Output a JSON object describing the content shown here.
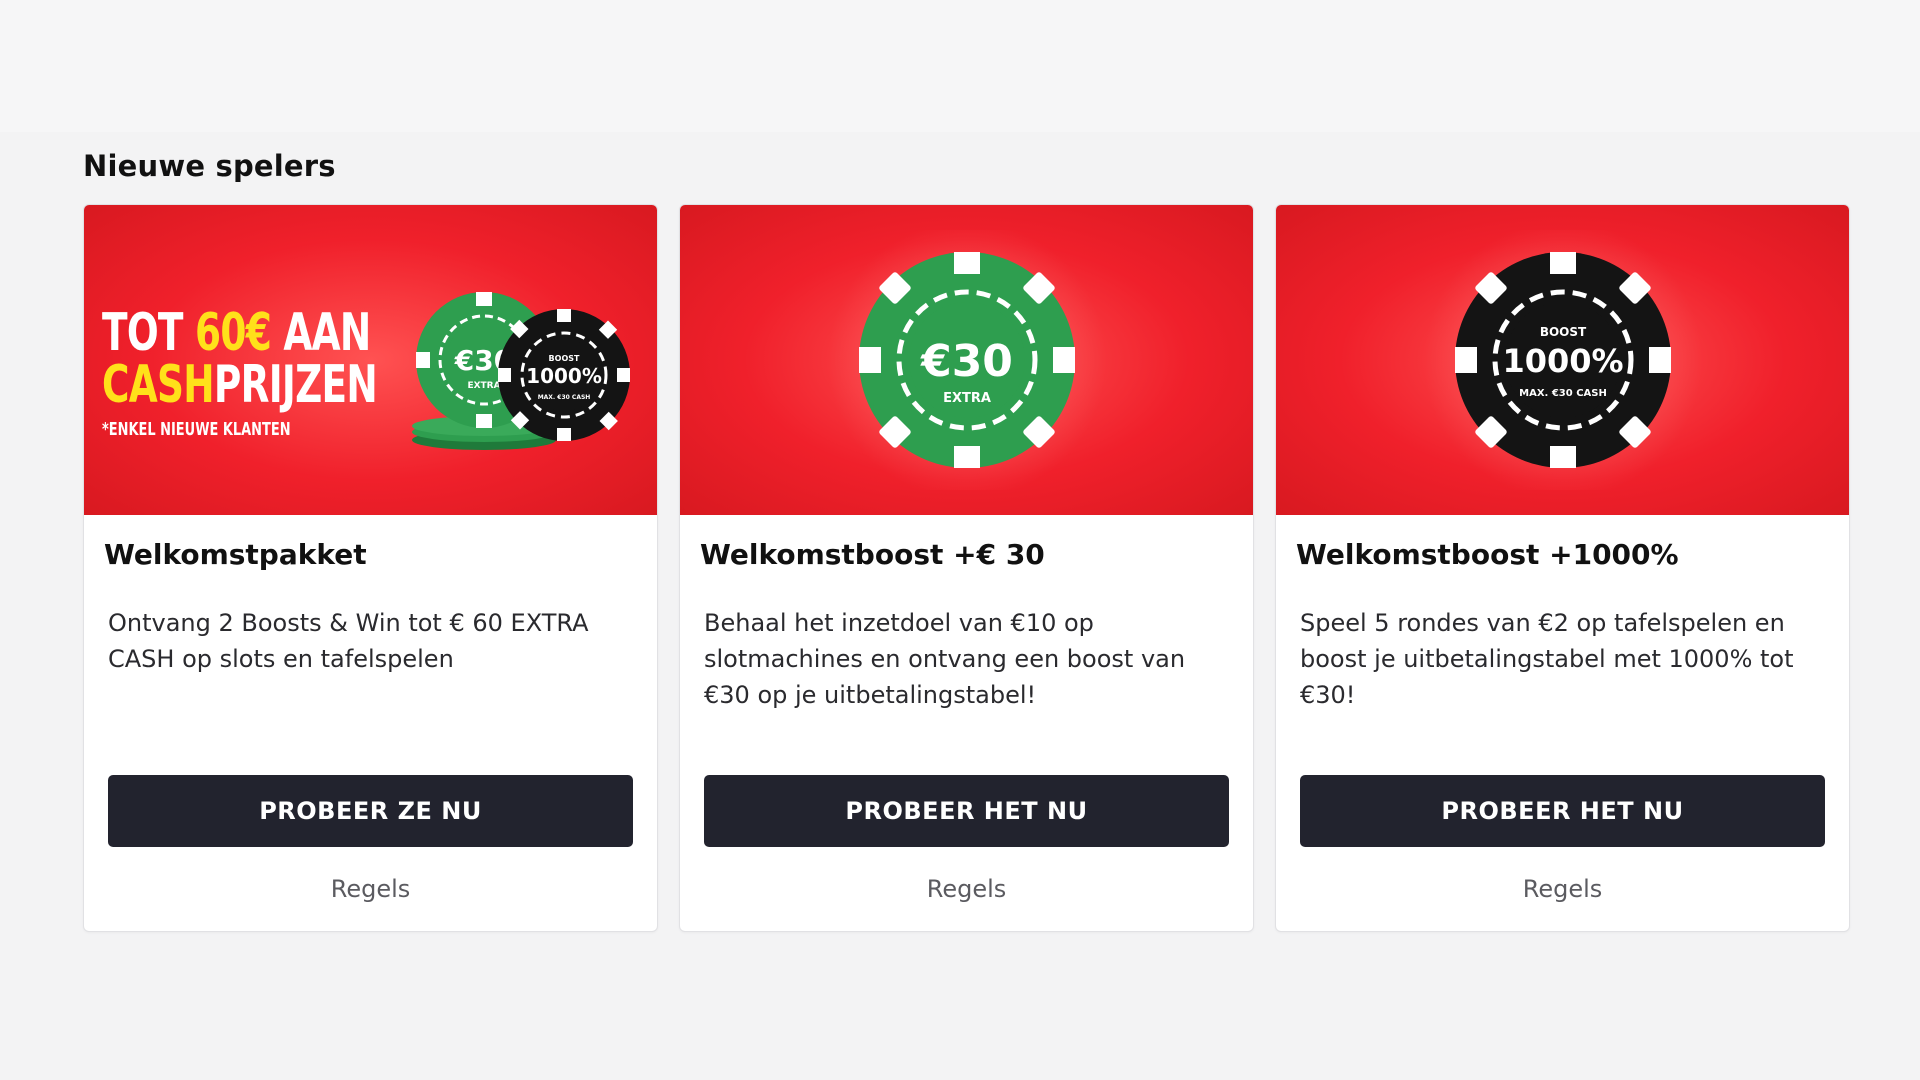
{
  "section": {
    "title": "Nieuwe spelers"
  },
  "colors": {
    "banner_red": "#f0202b",
    "cta_dark": "#22232e",
    "chip_green": "#2e9e4f",
    "chip_black": "#141414",
    "promo_yellow": "#ffe11a"
  },
  "cards": [
    {
      "title": "Welkomstpakket",
      "description": "Ontvang 2 Boosts & Win tot € 60 EXTRA CASH op slots en tafelspelen",
      "cta_label": "PROBEER ZE NU",
      "rules_label": "Regels",
      "banner": {
        "line1_a": "TOT ",
        "line1_b": "60€",
        "line1_c": " AAN",
        "line2_a": "CASH",
        "line2_b": "PRIJZEN",
        "footnote": "*ENKEL NIEUWE KLANTEN",
        "chip_green_value": "€30",
        "chip_green_sub": "EXTRA",
        "chip_black_top": "BOOST",
        "chip_black_value": "1000%",
        "chip_black_sub": "MAX. €30 CASH"
      }
    },
    {
      "title": "Welkomstboost +€ 30",
      "description": "Behaal het inzetdoel van €10 op slotmachines en ontvang een boost van €30 op je uitbetalingstabel!",
      "cta_label": "PROBEER HET NU",
      "rules_label": "Regels",
      "banner": {
        "chip_value": "€30",
        "chip_sub": "EXTRA"
      }
    },
    {
      "title": "Welkomstboost +1000%",
      "description": "Speel 5 rondes van €2 op tafelspelen en boost je uitbetalingstabel met 1000% tot €30!",
      "cta_label": "PROBEER HET NU",
      "rules_label": "Regels",
      "banner": {
        "chip_top": "BOOST",
        "chip_value": "1000%",
        "chip_sub": "MAX. €30 CASH"
      }
    }
  ]
}
